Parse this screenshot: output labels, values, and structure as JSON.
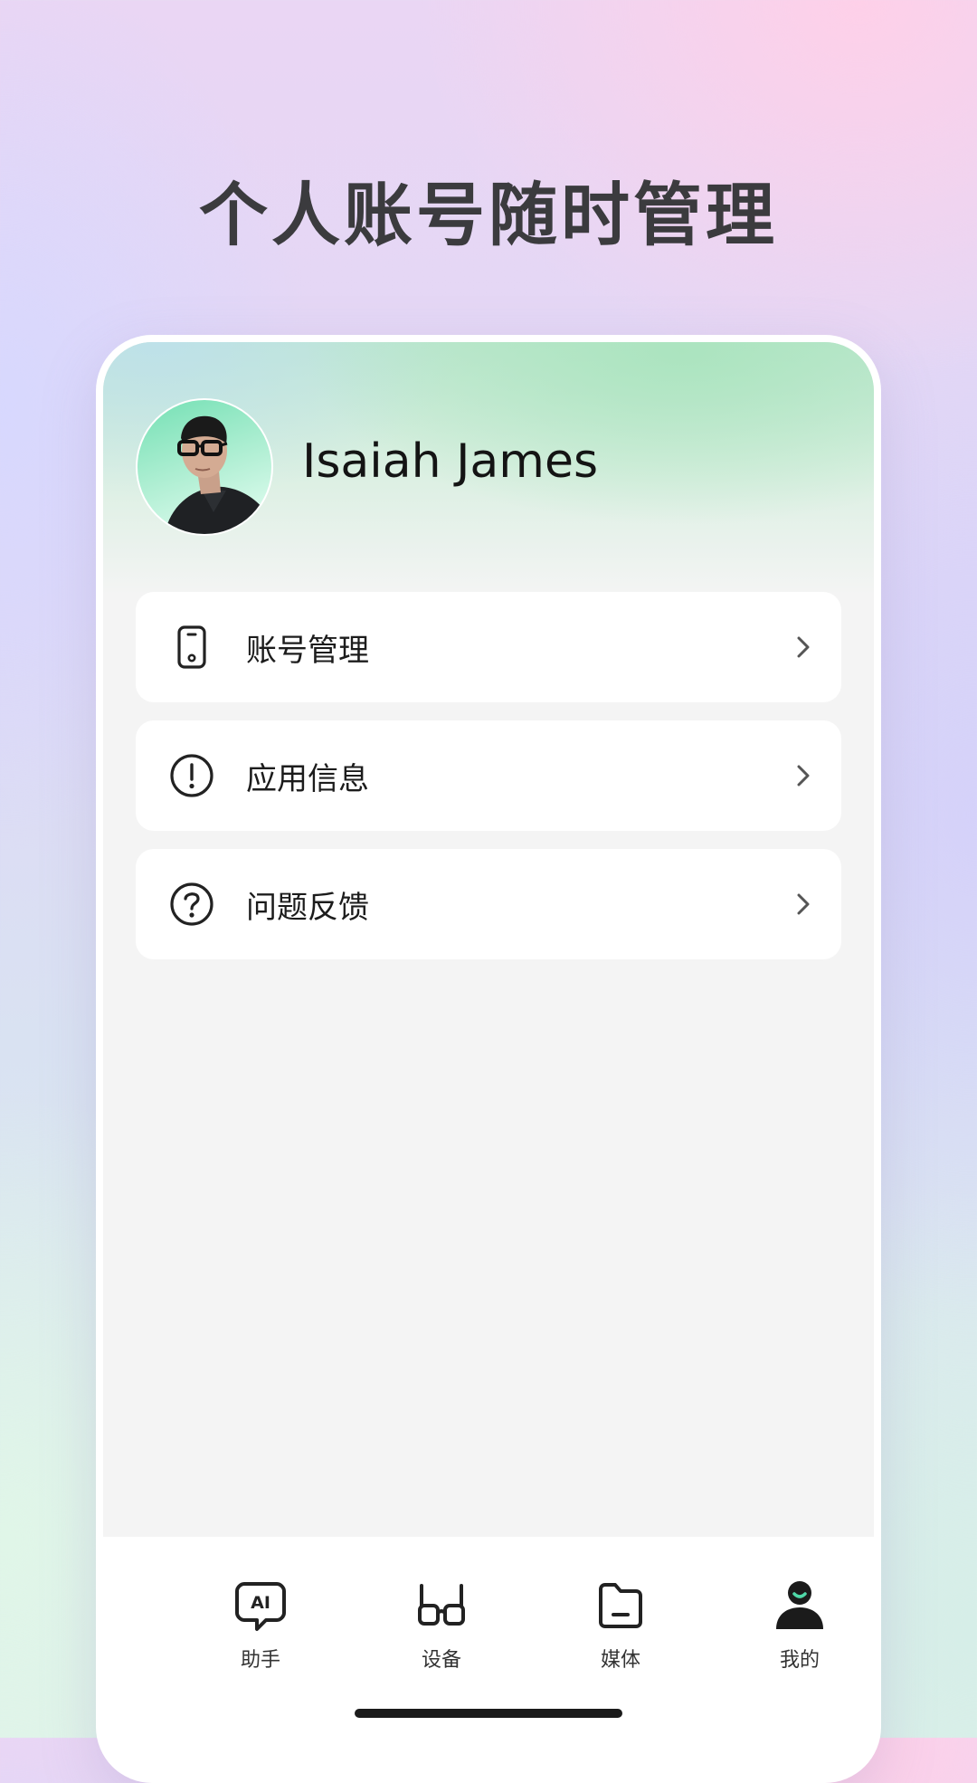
{
  "headline": "个人账号随时管理",
  "profile": {
    "name": "Isaiah James",
    "avatar": "user-avatar-photo"
  },
  "menu": [
    {
      "label": "账号管理",
      "icon": "phone-icon"
    },
    {
      "label": "应用信息",
      "icon": "info-icon"
    },
    {
      "label": "问题反馈",
      "icon": "help-icon"
    }
  ],
  "nav": [
    {
      "label": "助手",
      "icon": "ai-chat-icon",
      "active": false
    },
    {
      "label": "设备",
      "icon": "glasses-icon",
      "active": false
    },
    {
      "label": "媒体",
      "icon": "folder-icon",
      "active": false
    },
    {
      "label": "我的",
      "icon": "person-icon",
      "active": true
    }
  ],
  "colors": {
    "headline": "#3b3b3e",
    "accent": "#4fd8a8",
    "text": "#1c1c1c"
  }
}
